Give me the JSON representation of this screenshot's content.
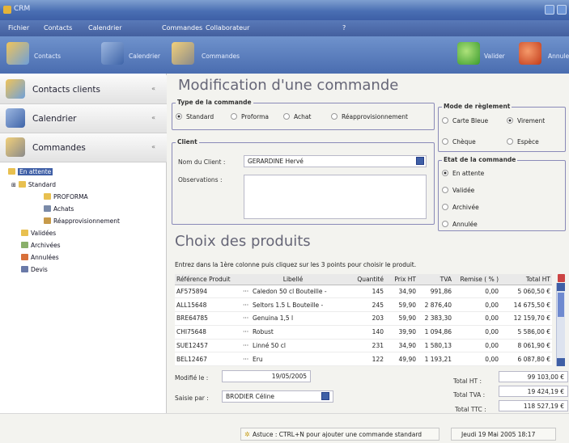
{
  "window": {
    "title": "CRM",
    "icon": "app-icon"
  },
  "menu": [
    "Fichier",
    "Contacts",
    "Calendrier",
    "Commandes",
    "Collaborateur",
    "?"
  ],
  "toolbar": {
    "left": [
      {
        "label": "Contacts",
        "icon": "contacts-icon"
      },
      {
        "label": "Calendrier",
        "icon": "calendar-icon"
      },
      {
        "label": "Commandes",
        "icon": "orders-icon"
      }
    ],
    "right": [
      {
        "label": "Valider",
        "icon": "check-icon"
      },
      {
        "label": "Annuler",
        "icon": "cancel-icon"
      }
    ]
  },
  "sidebar": {
    "sections": [
      {
        "label": "Contacts clients",
        "icon": "contacts-icon",
        "toggle": "«"
      },
      {
        "label": "Calendrier",
        "icon": "calendar-icon",
        "toggle": "«"
      },
      {
        "label": "Commandes",
        "icon": "orders-icon",
        "toggle": "«"
      }
    ],
    "tree": [
      {
        "label": "En attente",
        "selected": true
      },
      {
        "label": "Standard",
        "expander": "⊞"
      },
      {
        "label": "PROFORMA"
      },
      {
        "label": "Achats"
      },
      {
        "label": "Réapprovisionnement"
      },
      {
        "label": "Validées"
      },
      {
        "label": "Archivées"
      },
      {
        "label": "Annulées"
      },
      {
        "label": "Devis"
      }
    ]
  },
  "form": {
    "title": "Modification d'une commande",
    "type_legend": "Type de la commande",
    "types": [
      {
        "label": "Standard",
        "checked": true
      },
      {
        "label": "Proforma",
        "checked": false
      },
      {
        "label": "Achat",
        "checked": false
      },
      {
        "label": "Réapprovisionnement",
        "checked": false
      }
    ],
    "client_legend": "Client",
    "client_label": "Nom du Client :",
    "client_value": "GERARDINE Hervé",
    "observations_label": "Observations :",
    "payment_legend": "Mode de règlement",
    "payments": [
      {
        "label": "Carte Bleue",
        "checked": false
      },
      {
        "label": "Virement",
        "checked": true
      },
      {
        "label": "Chèque",
        "checked": false
      },
      {
        "label": "Espèce",
        "checked": false
      }
    ],
    "state_legend": "Etat de la commande",
    "states": [
      {
        "label": "En attente",
        "checked": true
      },
      {
        "label": "Validée",
        "checked": false
      },
      {
        "label": "Archivée",
        "checked": false
      },
      {
        "label": "Annulée",
        "checked": false
      }
    ]
  },
  "products": {
    "title": "Choix des produits",
    "instructions": "Entrez dans la 1ère colonne puis cliquez sur les 3 points pour choisir le produit.",
    "columns": [
      "Référence Produit",
      "Libellé",
      "Quantité",
      "Prix HT",
      "TVA",
      "Remise ( % )",
      "Total HT"
    ],
    "rows": [
      [
        "AF575894",
        "···",
        "Caledon 50 cl Bouteille -",
        "145",
        "34,90",
        "991,86",
        "0,00",
        "5 060,50 €"
      ],
      [
        "ALL15648",
        "···",
        "Seltors 1.5 L Bouteille -",
        "245",
        "59,90",
        "2 876,40",
        "0,00",
        "14 675,50 €"
      ],
      [
        "BRE64785",
        "···",
        "Genuina 1,5 l",
        "203",
        "59,90",
        "2 383,30",
        "0,00",
        "12 159,70 €"
      ],
      [
        "CHI75648",
        "···",
        "Robust",
        "140",
        "39,90",
        "1 094,86",
        "0,00",
        "5 586,00 €"
      ],
      [
        "SUE12457",
        "···",
        "Linné 50 cl",
        "231",
        "34,90",
        "1 580,13",
        "0,00",
        "8 061,90 €"
      ],
      [
        "BEL12467",
        "···",
        "Eru",
        "122",
        "49,90",
        "1 193,21",
        "0,00",
        "6 087,80 €"
      ]
    ]
  },
  "footer": {
    "modified_label": "Modifié le :",
    "modified_value": "19/05/2005",
    "entered_label": "Saisie par :",
    "entered_value": "BRODIER Céline",
    "total_ht_label": "Total HT :",
    "total_ht": "99 103,00 €",
    "total_tva_label": "Total TVA :",
    "total_tva": "19 424,19 €",
    "total_ttc_label": "Total TTC :",
    "total_ttc": "118 527,19 €"
  },
  "status": {
    "tip": "Astuce : CTRL+N pour ajouter une commande standard",
    "datetime": "Jeudi 19 Mai 2005 18:17"
  }
}
